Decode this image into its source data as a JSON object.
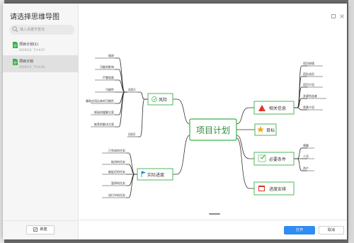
{
  "sidebar": {
    "title": "请选择思维导图",
    "search_placeholder": "输入关键字查找",
    "files": [
      {
        "name": "项目计划(1)",
        "date": "2019/1/1 下午4:07"
      },
      {
        "name": "项目计划",
        "date": "2019/1/1 下午4:00"
      }
    ],
    "new_label": "新建"
  },
  "mindmap": {
    "central": "项目计划",
    "right_nodes": {
      "related_info": {
        "label": "相关信息",
        "children": [
          "项目经理",
          "团队成员",
          "项目介绍",
          "关键利益者",
          "背景介绍"
        ]
      },
      "goal": {
        "label": "目标"
      },
      "requirements": {
        "label": "必要条件",
        "children": [
          "预算",
          "人员",
          "资产"
        ]
      },
      "progress_plan": {
        "label": "进度安排"
      }
    },
    "left_nodes": {
      "risk": {
        "label": "风险",
        "sub1": "风险1",
        "sub2": "风险2",
        "children": [
          "描述",
          "可能的影响",
          "严重程度",
          "可能性",
          "事前应用出来的可能性",
          "根因的缓解方案",
          "推荐的解决方案"
        ]
      },
      "actual_progress": {
        "label": "实际进度",
        "children": [
          "已完成的任务",
          "取消的任务",
          "被延迟的任务",
          "暂停的任务",
          "进行中的任务"
        ]
      }
    }
  },
  "footer": {
    "open_label": "打开",
    "cancel_label": "取消"
  },
  "colors": {
    "central_border": "#3bb04a",
    "central_text": "#2e8b3a",
    "node_border": "#3bb04a",
    "risk_border": "#3bb04a",
    "primary": "#2f8cf5"
  }
}
